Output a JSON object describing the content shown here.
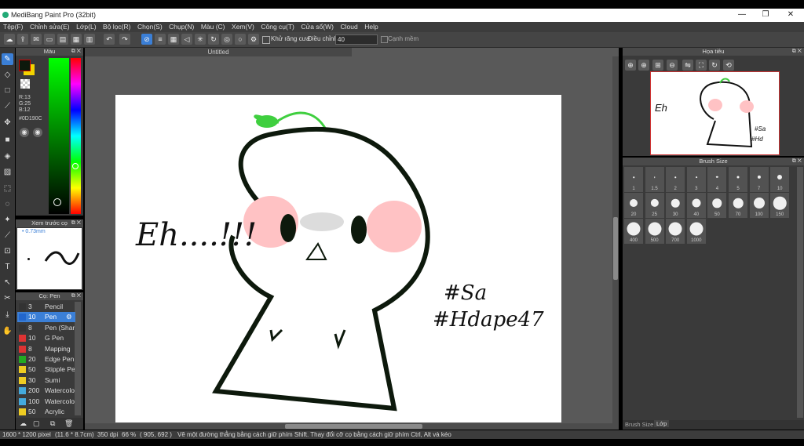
{
  "window": {
    "title": "MediBang Paint Pro (32bit)",
    "min": "—",
    "max": "❐",
    "close": "✕"
  },
  "menu": [
    "Tệp(F)",
    "Chỉnh sửa(E)",
    "Lớp(L)",
    "Bộ lọc(R)",
    "Chọn(S)",
    "Chụp(N)",
    "Màu (C)",
    "Xem(V)",
    "Công cụ(T)",
    "Cửa sổ(W)",
    "Cloud",
    "Help"
  ],
  "toolbar": {
    "antialias_label": "Khử răng cưa",
    "adjust_label": "Điều chỉnh",
    "adjust_value": "40",
    "smooth_label": "Cạnh mềm"
  },
  "color_panel": {
    "title": "Màu",
    "r": "R:13",
    "g": "G:25",
    "b": "B:12",
    "hex": "#0D190C",
    "fg_color": "#0d190c",
    "bg_color": "#f2d300"
  },
  "preview_panel": {
    "title": "Xem trước cọ",
    "size": "0.73mm"
  },
  "brush_panel": {
    "title": "Cọ: Pen",
    "items": [
      {
        "size": "3",
        "name": "Pencil",
        "color": "#333333"
      },
      {
        "size": "10",
        "name": "Pen",
        "color": "#2266cc",
        "selected": true
      },
      {
        "size": "8",
        "name": "Pen (Shar",
        "color": "#333333"
      },
      {
        "size": "10",
        "name": "G Pen",
        "color": "#dd3333"
      },
      {
        "size": "8",
        "name": "Mapping",
        "color": "#dd3333"
      },
      {
        "size": "20",
        "name": "Edge Pen",
        "color": "#22aa22"
      },
      {
        "size": "50",
        "name": "Stipple Pe",
        "color": "#eecc22"
      },
      {
        "size": "30",
        "name": "Sumi",
        "color": "#eecc22"
      },
      {
        "size": "200",
        "name": "Watercolo",
        "color": "#44aadd"
      },
      {
        "size": "100",
        "name": "Watercolo",
        "color": "#44aadd"
      },
      {
        "size": "50",
        "name": "Acrylic",
        "color": "#eecc22"
      }
    ]
  },
  "canvas": {
    "tab_title": "Untitled"
  },
  "drawing": {
    "text_left": "Eh....!!!",
    "text_right_1": "#Sa",
    "text_right_2": "#Hdape47"
  },
  "navigator": {
    "title": "Họa tiêu"
  },
  "brush_size": {
    "title": "Brush Size",
    "sizes": [
      "1",
      "1.5",
      "2",
      "3",
      "4",
      "5",
      "7",
      "10",
      "20",
      "25",
      "30",
      "40",
      "50",
      "70",
      "100",
      "150",
      "400",
      "500",
      "700",
      "1000"
    ]
  },
  "bottom_tabs": [
    "Brush Size",
    "Lớp"
  ],
  "status": {
    "dims": "1600 * 1200 pixel",
    "cm": "(11.6 * 8.7cm)",
    "dpi": "350 dpi",
    "zoom": "66 %",
    "coords": "( 905, 692 )",
    "hint": "Vẽ một đường thẳng bằng cách giữ phím Shift. Thay đổi cỡ cọ bằng cách giữ phím Ctrl, Alt và kéo"
  }
}
